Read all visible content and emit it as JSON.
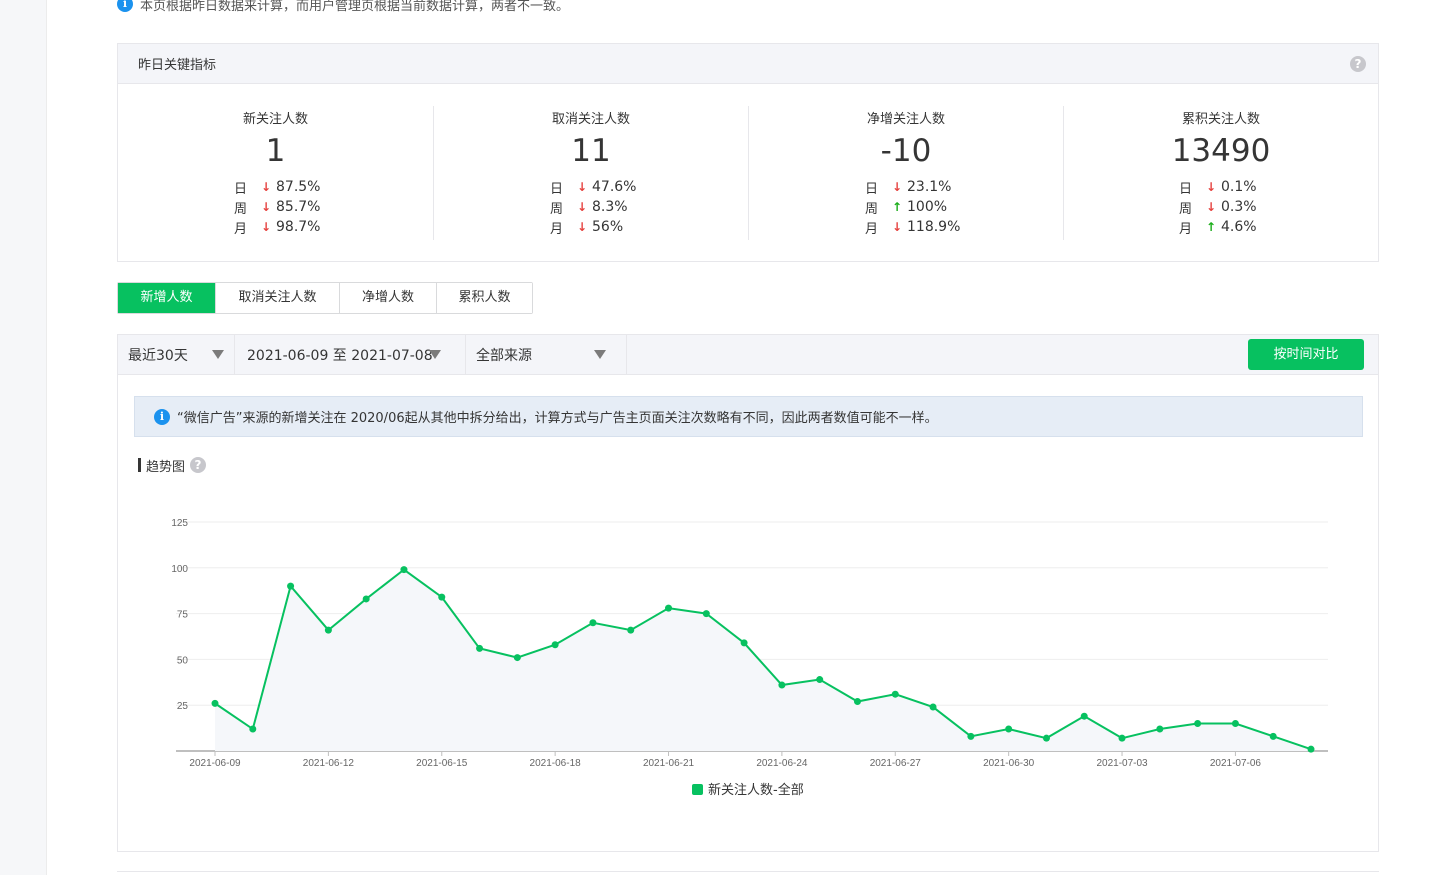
{
  "top_note": "本页根据昨日数据来计算，而用户管理页根据当前数据计算，两者不一致。",
  "kpi": {
    "header": "昨日关键指标",
    "items": [
      {
        "label": "新关注人数",
        "value": "1",
        "trends": [
          {
            "period": "日",
            "dir": "down",
            "pct": "87.5%"
          },
          {
            "period": "周",
            "dir": "down",
            "pct": "85.7%"
          },
          {
            "period": "月",
            "dir": "down",
            "pct": "98.7%"
          }
        ]
      },
      {
        "label": "取消关注人数",
        "value": "11",
        "trends": [
          {
            "period": "日",
            "dir": "down",
            "pct": "47.6%"
          },
          {
            "period": "周",
            "dir": "down",
            "pct": "8.3%"
          },
          {
            "period": "月",
            "dir": "down",
            "pct": "56%"
          }
        ]
      },
      {
        "label": "净增关注人数",
        "value": "-10",
        "trends": [
          {
            "period": "日",
            "dir": "down",
            "pct": "23.1%"
          },
          {
            "period": "周",
            "dir": "up",
            "pct": "100%"
          },
          {
            "period": "月",
            "dir": "down",
            "pct": "118.9%"
          }
        ]
      },
      {
        "label": "累积关注人数",
        "value": "13490",
        "trends": [
          {
            "period": "日",
            "dir": "down",
            "pct": "0.1%"
          },
          {
            "period": "周",
            "dir": "down",
            "pct": "0.3%"
          },
          {
            "period": "月",
            "dir": "up",
            "pct": "4.6%"
          }
        ]
      }
    ]
  },
  "tabs": [
    "新增人数",
    "取消关注人数",
    "净增人数",
    "累积人数"
  ],
  "toolbar": {
    "range": "最近30天",
    "dates": "2021-06-09 至 2021-07-08",
    "source": "全部来源",
    "compare": "按时间对比"
  },
  "notice": "“微信广告”来源的新增关注在 2020/06起从其他中拆分给出，计算方式与广告主页面关注次数略有不同，因此两者数值可能不一样。",
  "trend_title": "趋势图",
  "colors": {
    "accent": "#07c160",
    "down": "#e64340",
    "up": "#1aad19",
    "info": "#1b92ee"
  },
  "chart_data": {
    "type": "area",
    "x": [
      "2021-06-09",
      "2021-06-10",
      "2021-06-11",
      "2021-06-12",
      "2021-06-13",
      "2021-06-14",
      "2021-06-15",
      "2021-06-16",
      "2021-06-17",
      "2021-06-18",
      "2021-06-19",
      "2021-06-20",
      "2021-06-21",
      "2021-06-22",
      "2021-06-23",
      "2021-06-24",
      "2021-06-25",
      "2021-06-26",
      "2021-06-27",
      "2021-06-28",
      "2021-06-29",
      "2021-06-30",
      "2021-07-01",
      "2021-07-02",
      "2021-07-03",
      "2021-07-04",
      "2021-07-05",
      "2021-07-06",
      "2021-07-07",
      "2021-07-08"
    ],
    "xticks": [
      "2021-06-09",
      "2021-06-12",
      "2021-06-15",
      "2021-06-18",
      "2021-06-21",
      "2021-06-24",
      "2021-06-27",
      "2021-06-30",
      "2021-07-03",
      "2021-07-06"
    ],
    "yticks": [
      25,
      50,
      75,
      100,
      125
    ],
    "ylim": [
      0,
      125
    ],
    "grid": true,
    "legend_position": "bottom",
    "series": [
      {
        "name": "新关注人数-全部",
        "color": "#07c160",
        "values": [
          26,
          12,
          90,
          66,
          83,
          99,
          84,
          56,
          51,
          58,
          70,
          66,
          78,
          75,
          59,
          36,
          39,
          27,
          31,
          24,
          8,
          12,
          7,
          19,
          7,
          12,
          15,
          15,
          8,
          1
        ]
      }
    ]
  }
}
